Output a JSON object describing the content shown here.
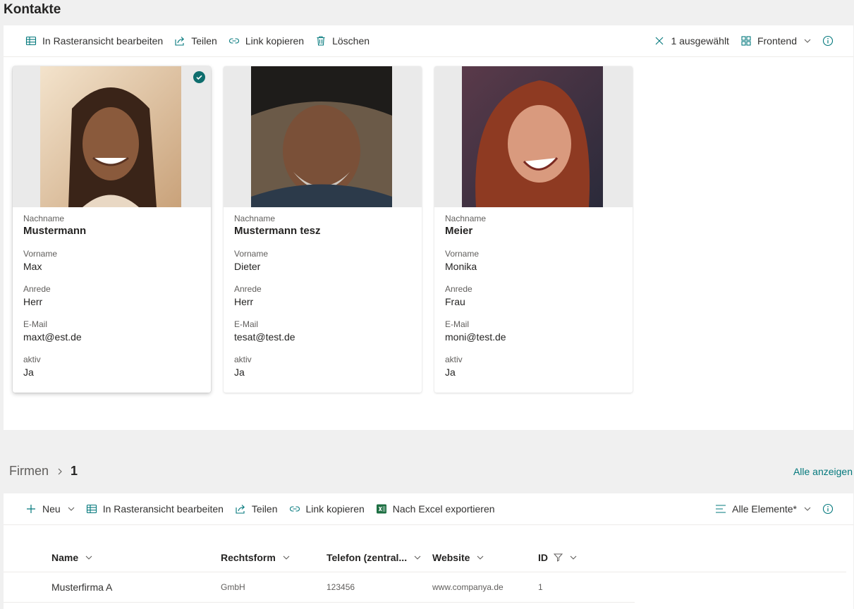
{
  "contacts": {
    "title": "Kontakte",
    "toolbar": {
      "grid_edit": "In Rasteransicht bearbeiten",
      "share": "Teilen",
      "copy_link": "Link kopieren",
      "delete": "Löschen",
      "selected": "1 ausgewählt",
      "view": "Frontend"
    },
    "field_labels": {
      "nachname": "Nachname",
      "vorname": "Vorname",
      "anrede": "Anrede",
      "email": "E-Mail",
      "aktiv": "aktiv"
    },
    "cards": [
      {
        "nachname": "Mustermann",
        "vorname": "Max",
        "anrede": "Herr",
        "email": "maxt@est.de",
        "aktiv": "Ja"
      },
      {
        "nachname": "Mustermann tesz",
        "vorname": "Dieter",
        "anrede": "Herr",
        "email": "tesat@test.de",
        "aktiv": "Ja"
      },
      {
        "nachname": "Meier",
        "vorname": "Monika",
        "anrede": "Frau",
        "email": "moni@test.de",
        "aktiv": "Ja"
      }
    ]
  },
  "companies": {
    "breadcrumb_root": "Firmen",
    "breadcrumb_current": "1",
    "show_all": "Alle anzeigen",
    "toolbar": {
      "new": "Neu",
      "grid_edit": "In Rasteransicht bearbeiten",
      "share": "Teilen",
      "copy_link": "Link kopieren",
      "export": "Nach Excel exportieren",
      "view": "Alle Elemente*"
    },
    "columns": [
      "Name",
      "Rechtsform",
      "Telefon (zentral...",
      "Website",
      "ID"
    ],
    "rows": [
      {
        "name": "Musterfirma A",
        "rechtsform": "GmbH",
        "telefon": "123456",
        "website": "www.companya.de",
        "id": "1"
      }
    ]
  },
  "colors": {
    "accent": "#03787c",
    "check": "#0f6e6e",
    "excel": "#1d6f42"
  }
}
